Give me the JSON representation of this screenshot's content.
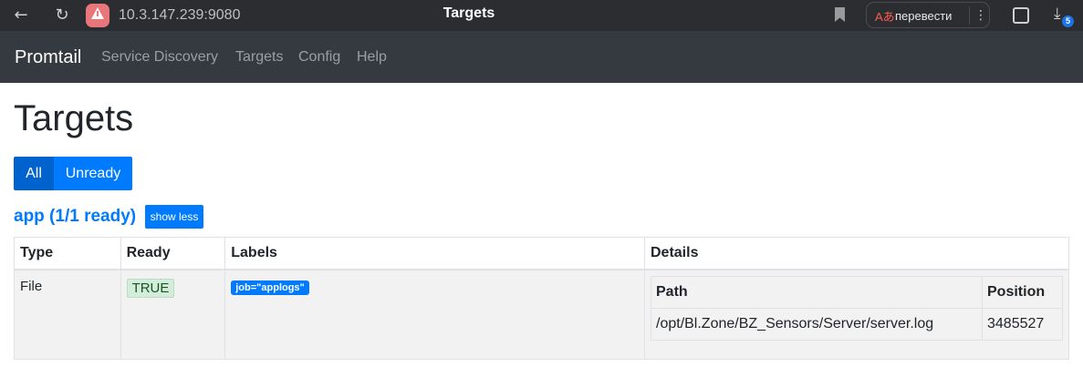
{
  "browser": {
    "url": "10.3.147.239:9080",
    "tab_title": "Targets",
    "translate_label": "перевести",
    "translate_icon": "Аあ",
    "download_badge": "5",
    "icons": [
      "back-arrow-icon",
      "reload-icon",
      "warning-icon",
      "bookmark-icon",
      "translate-icon",
      "more-icon",
      "extensions-icon",
      "download-icon"
    ]
  },
  "navbar": {
    "brand": "Promtail",
    "links": [
      "Service Discovery",
      "Targets",
      "Config",
      "Help"
    ]
  },
  "page": {
    "title": "Targets",
    "filter": {
      "all": "All",
      "unready": "Unready"
    }
  },
  "job": {
    "heading": "app (1/1 ready)",
    "toggle": "show less",
    "columns": [
      "Type",
      "Ready",
      "Labels",
      "Details"
    ],
    "row": {
      "type": "File",
      "ready": "TRUE",
      "label": "job=\"applogs\"",
      "details": {
        "columns": [
          "Path",
          "Position"
        ],
        "path": "/opt/Bl.Zone/BZ_Sensors/Server/server.log",
        "position": "3485527"
      }
    }
  },
  "colors": {
    "navbar_bg": "#343a40",
    "primary": "#007bff",
    "primary_active": "#0062cc",
    "success_bg": "#d4edda"
  }
}
